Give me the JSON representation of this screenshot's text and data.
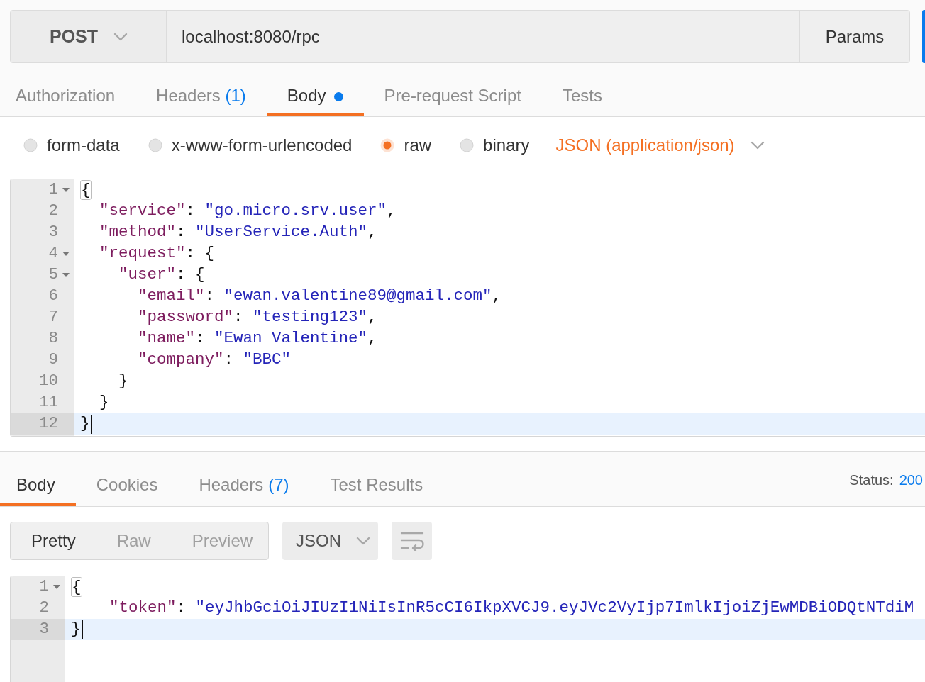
{
  "request": {
    "method": "POST",
    "url": "localhost:8080/rpc",
    "params_button": "Params"
  },
  "request_tabs": [
    {
      "label": "Authorization",
      "selected": false,
      "indicator": false
    },
    {
      "label": "Headers",
      "count": "(1)",
      "selected": false,
      "indicator": false
    },
    {
      "label": "Body",
      "selected": true,
      "indicator": true
    },
    {
      "label": "Pre-request Script",
      "selected": false,
      "indicator": false
    },
    {
      "label": "Tests",
      "selected": false,
      "indicator": false
    }
  ],
  "body_types": [
    {
      "label": "form-data",
      "selected": false
    },
    {
      "label": "x-www-form-urlencoded",
      "selected": false
    },
    {
      "label": "raw",
      "selected": true
    },
    {
      "label": "binary",
      "selected": false
    }
  ],
  "body_format": "JSON (application/json)",
  "request_body": {
    "lines": [
      {
        "number": "1",
        "fold": true,
        "active": false,
        "bracket_match": true,
        "tokens": [
          {
            "kind": "punct",
            "text": "{"
          }
        ]
      },
      {
        "number": "2",
        "fold": false,
        "active": false,
        "bracket_match": false,
        "tokens": [
          {
            "kind": "key",
            "text": "  \"service\""
          },
          {
            "kind": "punct",
            "text": ": "
          },
          {
            "kind": "string",
            "text": "\"go.micro.srv.user\""
          },
          {
            "kind": "punct",
            "text": ","
          }
        ]
      },
      {
        "number": "3",
        "fold": false,
        "active": false,
        "bracket_match": false,
        "tokens": [
          {
            "kind": "key",
            "text": "  \"method\""
          },
          {
            "kind": "punct",
            "text": ": "
          },
          {
            "kind": "string",
            "text": "\"UserService.Auth\""
          },
          {
            "kind": "punct",
            "text": ","
          }
        ]
      },
      {
        "number": "4",
        "fold": true,
        "active": false,
        "bracket_match": false,
        "tokens": [
          {
            "kind": "key",
            "text": "  \"request\""
          },
          {
            "kind": "punct",
            "text": ": {"
          }
        ]
      },
      {
        "number": "5",
        "fold": true,
        "active": false,
        "bracket_match": false,
        "tokens": [
          {
            "kind": "key",
            "text": "    \"user\""
          },
          {
            "kind": "punct",
            "text": ": {"
          }
        ]
      },
      {
        "number": "6",
        "fold": false,
        "active": false,
        "bracket_match": false,
        "tokens": [
          {
            "kind": "key",
            "text": "      \"email\""
          },
          {
            "kind": "punct",
            "text": ": "
          },
          {
            "kind": "string",
            "text": "\"ewan.valentine89@gmail.com\""
          },
          {
            "kind": "punct",
            "text": ","
          }
        ]
      },
      {
        "number": "7",
        "fold": false,
        "active": false,
        "bracket_match": false,
        "tokens": [
          {
            "kind": "key",
            "text": "      \"password\""
          },
          {
            "kind": "punct",
            "text": ": "
          },
          {
            "kind": "string",
            "text": "\"testing123\""
          },
          {
            "kind": "punct",
            "text": ","
          }
        ]
      },
      {
        "number": "8",
        "fold": false,
        "active": false,
        "bracket_match": false,
        "tokens": [
          {
            "kind": "key",
            "text": "      \"name\""
          },
          {
            "kind": "punct",
            "text": ": "
          },
          {
            "kind": "string",
            "text": "\"Ewan Valentine\""
          },
          {
            "kind": "punct",
            "text": ","
          }
        ]
      },
      {
        "number": "9",
        "fold": false,
        "active": false,
        "bracket_match": false,
        "tokens": [
          {
            "kind": "key",
            "text": "      \"company\""
          },
          {
            "kind": "punct",
            "text": ": "
          },
          {
            "kind": "string",
            "text": "\"BBC\""
          }
        ]
      },
      {
        "number": "10",
        "fold": false,
        "active": false,
        "bracket_match": false,
        "tokens": [
          {
            "kind": "punct",
            "text": "    }"
          }
        ]
      },
      {
        "number": "11",
        "fold": false,
        "active": false,
        "bracket_match": false,
        "tokens": [
          {
            "kind": "punct",
            "text": "  }"
          }
        ]
      },
      {
        "number": "12",
        "fold": false,
        "active": true,
        "bracket_match": false,
        "tokens": [
          {
            "kind": "punct",
            "text": "}"
          }
        ]
      }
    ]
  },
  "response_tabs": [
    {
      "label": "Body",
      "selected": true
    },
    {
      "label": "Cookies",
      "selected": false
    },
    {
      "label": "Headers",
      "count": "(7)",
      "selected": false
    },
    {
      "label": "Test Results",
      "selected": false
    }
  ],
  "status": {
    "label": "Status:",
    "code": "200"
  },
  "view_modes": [
    {
      "label": "Pretty",
      "selected": true
    },
    {
      "label": "Raw",
      "selected": false
    },
    {
      "label": "Preview",
      "selected": false
    }
  ],
  "response_format": "JSON",
  "response_body": {
    "lines": [
      {
        "number": "1",
        "fold": true,
        "active": false,
        "bracket_match": true,
        "tokens": [
          {
            "kind": "punct",
            "text": "{"
          }
        ]
      },
      {
        "number": "2",
        "fold": false,
        "active": false,
        "bracket_match": false,
        "tokens": [
          {
            "kind": "key",
            "text": "    \"token\""
          },
          {
            "kind": "punct",
            "text": ": "
          },
          {
            "kind": "string",
            "text": "\"eyJhbGciOiJIUzI1NiIsInR5cCI6IkpXVCJ9.eyJVc2VyIjp7ImlkIjoiZjEwMDBiODQtNTdiM"
          }
        ]
      },
      {
        "number": "3",
        "fold": false,
        "active": true,
        "bracket_match": false,
        "tokens": [
          {
            "kind": "punct",
            "text": "}"
          }
        ]
      }
    ]
  }
}
